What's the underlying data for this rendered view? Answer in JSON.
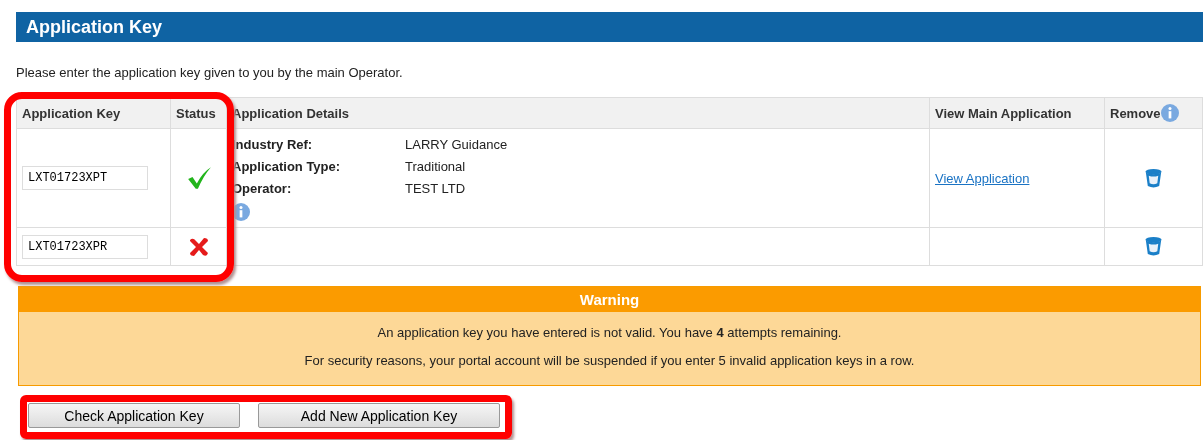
{
  "header": {
    "title": "Application Key"
  },
  "intro": "Please enter the application key given to you by the main Operator.",
  "table": {
    "columns": [
      "Application Key",
      "Status",
      "Application Details",
      "View Main Application",
      "Remove"
    ],
    "rows": [
      {
        "key": "LXT01723XPT",
        "valid": true,
        "details": [
          {
            "label": "Industry Ref:",
            "value": "LARRY Guidance"
          },
          {
            "label": "Application Type:",
            "value": "Traditional"
          },
          {
            "label": "Operator:",
            "value": "TEST LTD"
          }
        ],
        "link": "View Application"
      },
      {
        "key": "LXT01723XPR",
        "valid": false
      }
    ]
  },
  "warning": {
    "title": "Warning",
    "lines": [
      "An application key you have entered is not valid. You have **4** attempts remaining.",
      "For security reasons, your portal account will be suspended if you enter 5 invalid application keys in a row."
    ]
  },
  "buttons": [
    "Check Application Key",
    "Add New Application Key"
  ]
}
